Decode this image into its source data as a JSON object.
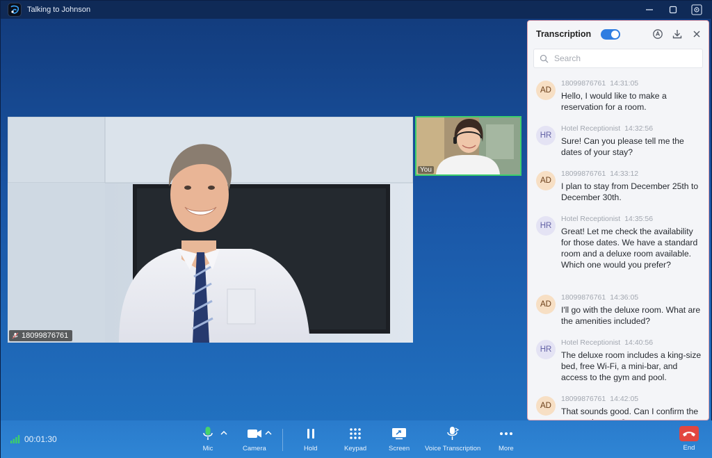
{
  "window": {
    "title": "Talking to Johnson"
  },
  "main_video": {
    "name_tag": "18099876761"
  },
  "self_video": {
    "label": "You"
  },
  "transcription": {
    "title": "Transcription",
    "toggle_on": true,
    "search_placeholder": "Search",
    "messages": [
      {
        "avatar": "AD",
        "sender": "18099876761",
        "time": "14:31:05",
        "text": "Hello, I would like to make a reservation for a room."
      },
      {
        "avatar": "HR",
        "sender": "Hotel Receptionist",
        "time": "14:32:56",
        "text": "Sure! Can you please tell me the dates of your stay?"
      },
      {
        "avatar": "AD",
        "sender": "18099876761",
        "time": "14:33:12",
        "text": "I plan to stay from December 25th to December 30th."
      },
      {
        "avatar": "HR",
        "sender": "Hotel Receptionist",
        "time": "14:35:56",
        "text": "Great! Let me check the availability for those dates. We have a standard room and a deluxe room available. Which one would you prefer?"
      },
      {
        "avatar": "AD",
        "sender": "18099876761",
        "time": "14:36:05",
        "text": "I'll go with the deluxe room. What are the amenities included?"
      },
      {
        "avatar": "HR",
        "sender": "Hotel Receptionist",
        "time": "14:40:56",
        "text": "The deluxe room includes a king-size bed, free Wi-Fi, a mini-bar, and access to the gym and pool."
      },
      {
        "avatar": "AD",
        "sender": "18099876761",
        "time": "14:42:05",
        "text": "That sounds good. Can I confirm the reservation now?"
      }
    ]
  },
  "controls": {
    "timer": "00:01:30",
    "mic": "Mic",
    "camera": "Camera",
    "hold": "Hold",
    "keypad": "Keypad",
    "screen": "Screen",
    "voice_transcription": "Voice Transcription",
    "more": "More",
    "end": "End"
  },
  "colors": {
    "accent": "#2f7de1",
    "end_call": "#e2463f",
    "self_video_border": "#3ccf6b",
    "signal": "#3ccf6b"
  }
}
